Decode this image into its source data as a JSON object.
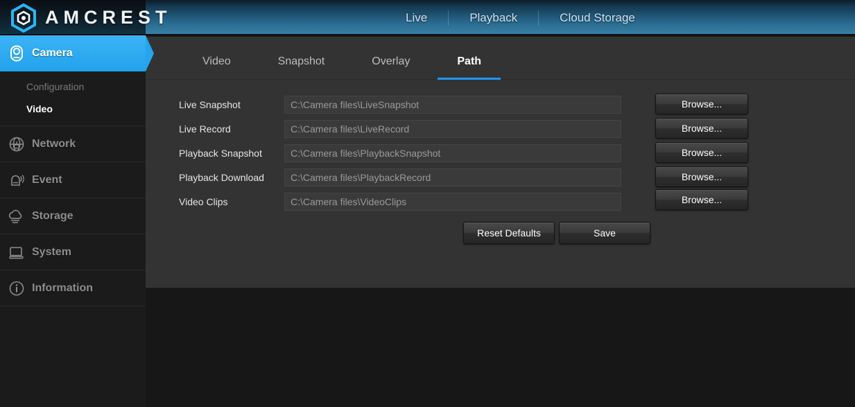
{
  "header": {
    "brand": "AMCREST",
    "logo_icon": "amcrest-hexagon-logo",
    "accent_color": "#2196f3",
    "nav": [
      {
        "label": "Live"
      },
      {
        "label": "Playback"
      },
      {
        "label": "Cloud Storage"
      }
    ]
  },
  "sidebar": {
    "items": [
      {
        "label": "Camera",
        "icon": "camera-icon",
        "active": true
      },
      {
        "label": "Network",
        "icon": "network-globe-icon",
        "active": false
      },
      {
        "label": "Event",
        "icon": "event-bell-icon",
        "active": false
      },
      {
        "label": "Storage",
        "icon": "storage-cloud-icon",
        "active": false
      },
      {
        "label": "System",
        "icon": "system-monitor-icon",
        "active": false
      },
      {
        "label": "Information",
        "icon": "information-circle-icon",
        "active": false
      }
    ],
    "camera_subitems": [
      {
        "label": "Configuration",
        "selected": false
      },
      {
        "label": "Video",
        "selected": true
      }
    ]
  },
  "main": {
    "tabs": [
      {
        "label": "Video",
        "active": false
      },
      {
        "label": "Snapshot",
        "active": false
      },
      {
        "label": "Overlay",
        "active": false
      },
      {
        "label": "Path",
        "active": true
      }
    ],
    "rows": [
      {
        "label": "Live Snapshot",
        "value": "C:\\Camera files\\LiveSnapshot",
        "button": "Browse..."
      },
      {
        "label": "Live Record",
        "value": "C:\\Camera files\\LiveRecord",
        "button": "Browse..."
      },
      {
        "label": "Playback Snapshot",
        "value": "C:\\Camera files\\PlaybackSnapshot",
        "button": "Browse..."
      },
      {
        "label": "Playback Download",
        "value": "C:\\Camera files\\PlaybackRecord",
        "button": "Browse..."
      },
      {
        "label": "Video Clips",
        "value": "C:\\Camera files\\VideoClips",
        "button": "Browse..."
      }
    ],
    "actions": {
      "reset_label": "Reset Defaults",
      "save_label": "Save"
    }
  }
}
